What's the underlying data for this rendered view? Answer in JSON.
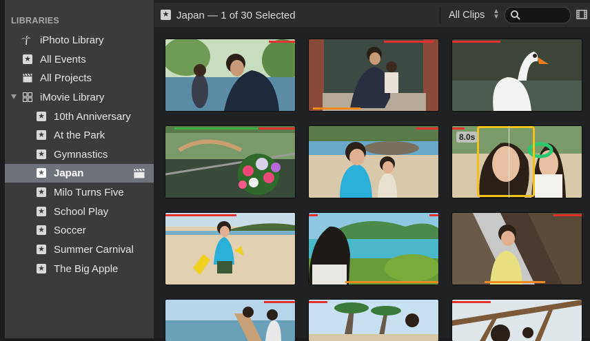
{
  "sidebar": {
    "header": "LIBRARIES",
    "items": [
      {
        "label": "iPhoto Library",
        "icon": "palm-tree-icon",
        "level": 0
      },
      {
        "label": "All Events",
        "icon": "star-icon",
        "level": 0
      },
      {
        "label": "All Projects",
        "icon": "clapboard-icon",
        "level": 0
      },
      {
        "label": "iMovie Library",
        "icon": "library-grid-icon",
        "level": 0,
        "expanded": true
      },
      {
        "label": "10th Anniversary",
        "icon": "star-icon",
        "level": 1
      },
      {
        "label": "At the Park",
        "icon": "star-icon",
        "level": 1
      },
      {
        "label": "Gymnastics",
        "icon": "star-icon",
        "level": 1
      },
      {
        "label": "Japan",
        "icon": "star-icon",
        "level": 1,
        "selected": true
      },
      {
        "label": "Milo Turns Five",
        "icon": "star-icon",
        "level": 1
      },
      {
        "label": "School Play",
        "icon": "star-icon",
        "level": 1
      },
      {
        "label": "Soccer",
        "icon": "star-icon",
        "level": 1
      },
      {
        "label": "Summer Carnival",
        "icon": "star-icon",
        "level": 1
      },
      {
        "label": "The Big Apple",
        "icon": "star-icon",
        "level": 1
      }
    ]
  },
  "toolbar": {
    "title": "Japan — 1 of 30 Selected",
    "filter_value": "All Clips",
    "search_placeholder": ""
  },
  "clips": [
    {
      "desc": "father-son-by-river",
      "red": [
        0.8,
        1.0
      ],
      "green": null,
      "orange": null
    },
    {
      "desc": "family-on-steps",
      "red": [
        0.58,
        0.96
      ],
      "green": null,
      "orange": [
        0.03,
        0.4
      ]
    },
    {
      "desc": "white-swan",
      "red": [
        0.0,
        0.37
      ],
      "green": null,
      "orange": null
    },
    {
      "desc": "flowers-by-bridge",
      "red": [
        0.7,
        1.0
      ],
      "green": [
        0.07,
        0.72
      ],
      "orange": null
    },
    {
      "desc": "kids-on-beach",
      "red": [
        0.83,
        1.0
      ],
      "green": null,
      "orange": null
    },
    {
      "desc": "mother-child-selected",
      "red": [
        0.0,
        0.1
      ],
      "green": null,
      "orange": null,
      "selected": true,
      "duration": "8.0s"
    },
    {
      "desc": "boy-with-shovels",
      "red": [
        0.0,
        0.55
      ],
      "green": null,
      "orange": null
    },
    {
      "desc": "woman-by-bay",
      "red": [
        0.0,
        0.07
      ],
      "green": null,
      "orange": [
        0.28,
        1.0
      ],
      "red2": [
        0.93,
        1.0
      ]
    },
    {
      "desc": "toddler-on-slide",
      "red": [
        0.78,
        1.0
      ],
      "green": null,
      "orange": [
        0.25,
        0.72
      ]
    },
    {
      "desc": "kids-at-playground",
      "red": [
        0.76,
        1.0
      ],
      "green": null,
      "orange": null
    },
    {
      "desc": "palm-trees-beach",
      "red": [
        0.0,
        0.14
      ],
      "green": null,
      "orange": null
    },
    {
      "desc": "wooden-pergola",
      "red": [
        0.0,
        0.3
      ],
      "green": null,
      "orange": null
    }
  ],
  "colors": {
    "sidebar_bg": "#3a3b3d",
    "selected_row": "#6e737b",
    "selection_border": "#f3c21a",
    "rejected_bar": "#e53030",
    "favorite_bar": "#3cb043",
    "keyword_bar": "#f08a1c"
  }
}
